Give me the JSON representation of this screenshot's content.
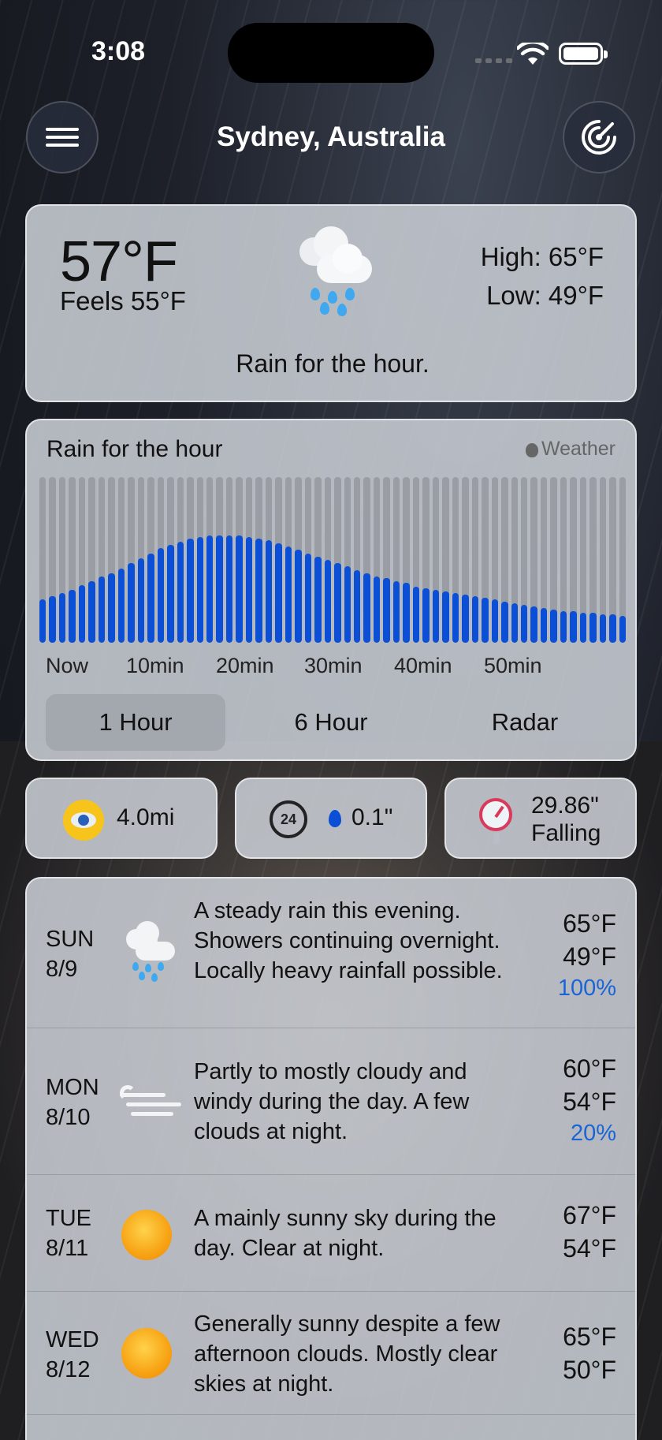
{
  "status_bar": {
    "time": "3:08"
  },
  "header": {
    "city": "Sydney, Australia",
    "menu_icon": "hamburger-menu-icon",
    "radar_icon": "radar-icon"
  },
  "current": {
    "temperature": "57°F",
    "feels_like": "Feels 55°F",
    "high": "High: 65°F",
    "low": "Low: 49°F",
    "summary": "Rain for the hour.",
    "icon": "rain-cloud-icon"
  },
  "precip_chart": {
    "title": "Rain for the hour",
    "brand": "Weather",
    "tick_labels": [
      "Now",
      "10min",
      "20min",
      "30min",
      "40min",
      "50min"
    ],
    "tabs": [
      {
        "label": "1 Hour",
        "active": true
      },
      {
        "label": "6 Hour",
        "active": false
      },
      {
        "label": "Radar",
        "active": false
      }
    ]
  },
  "chart_data": {
    "type": "bar",
    "title": "Rain for the hour",
    "x": [
      0,
      1,
      2,
      3,
      4,
      5,
      6,
      7,
      8,
      9,
      10,
      11,
      12,
      13,
      14,
      15,
      16,
      17,
      18,
      19,
      20,
      21,
      22,
      23,
      24,
      25,
      26,
      27,
      28,
      29,
      30,
      31,
      32,
      33,
      34,
      35,
      36,
      37,
      38,
      39,
      40,
      41,
      42,
      43,
      44,
      45,
      46,
      47,
      48,
      49,
      50,
      51,
      52,
      53,
      54,
      55,
      56,
      57,
      58,
      59
    ],
    "xlabel": "",
    "ylabel": "",
    "values": [
      0.26,
      0.28,
      0.3,
      0.32,
      0.35,
      0.37,
      0.4,
      0.42,
      0.45,
      0.48,
      0.51,
      0.54,
      0.57,
      0.59,
      0.61,
      0.63,
      0.64,
      0.65,
      0.65,
      0.65,
      0.65,
      0.64,
      0.63,
      0.62,
      0.6,
      0.58,
      0.56,
      0.54,
      0.52,
      0.5,
      0.48,
      0.46,
      0.44,
      0.42,
      0.4,
      0.39,
      0.37,
      0.36,
      0.34,
      0.33,
      0.32,
      0.31,
      0.3,
      0.29,
      0.28,
      0.27,
      0.26,
      0.25,
      0.24,
      0.23,
      0.22,
      0.21,
      0.2,
      0.19,
      0.19,
      0.18,
      0.18,
      0.17,
      0.17,
      0.16
    ],
    "ylim": [
      0,
      1
    ]
  },
  "details": {
    "visibility": "4.0mi",
    "rain_24h": "0.1\"",
    "pressure_value": "29.86\"",
    "pressure_trend": "Falling"
  },
  "forecast": [
    {
      "day": "SUN",
      "date": "8/9",
      "icon": "rain-cloud-icon",
      "description": "A steady rain this evening. Showers continuing overnight. Locally heavy rainfall possible.",
      "high": "65°F",
      "low": "49°F",
      "precip": "100%"
    },
    {
      "day": "MON",
      "date": "8/10",
      "icon": "wind-icon",
      "description": "Partly to mostly cloudy and windy during the day. A few clouds at night.",
      "high": "60°F",
      "low": "54°F",
      "precip": "20%"
    },
    {
      "day": "TUE",
      "date": "8/11",
      "icon": "sun-icon",
      "description": "A mainly sunny sky during the day. Clear at night.",
      "high": "67°F",
      "low": "54°F",
      "precip": ""
    },
    {
      "day": "WED",
      "date": "8/12",
      "icon": "sun-icon",
      "description": "Generally sunny despite a few afternoon clouds. Mostly clear skies at night.",
      "high": "65°F",
      "low": "50°F",
      "precip": ""
    }
  ],
  "colors": {
    "rain_bar": "#0a4fd6",
    "precip_text": "#1a64d6",
    "card_bg": "#c8cdd4"
  }
}
